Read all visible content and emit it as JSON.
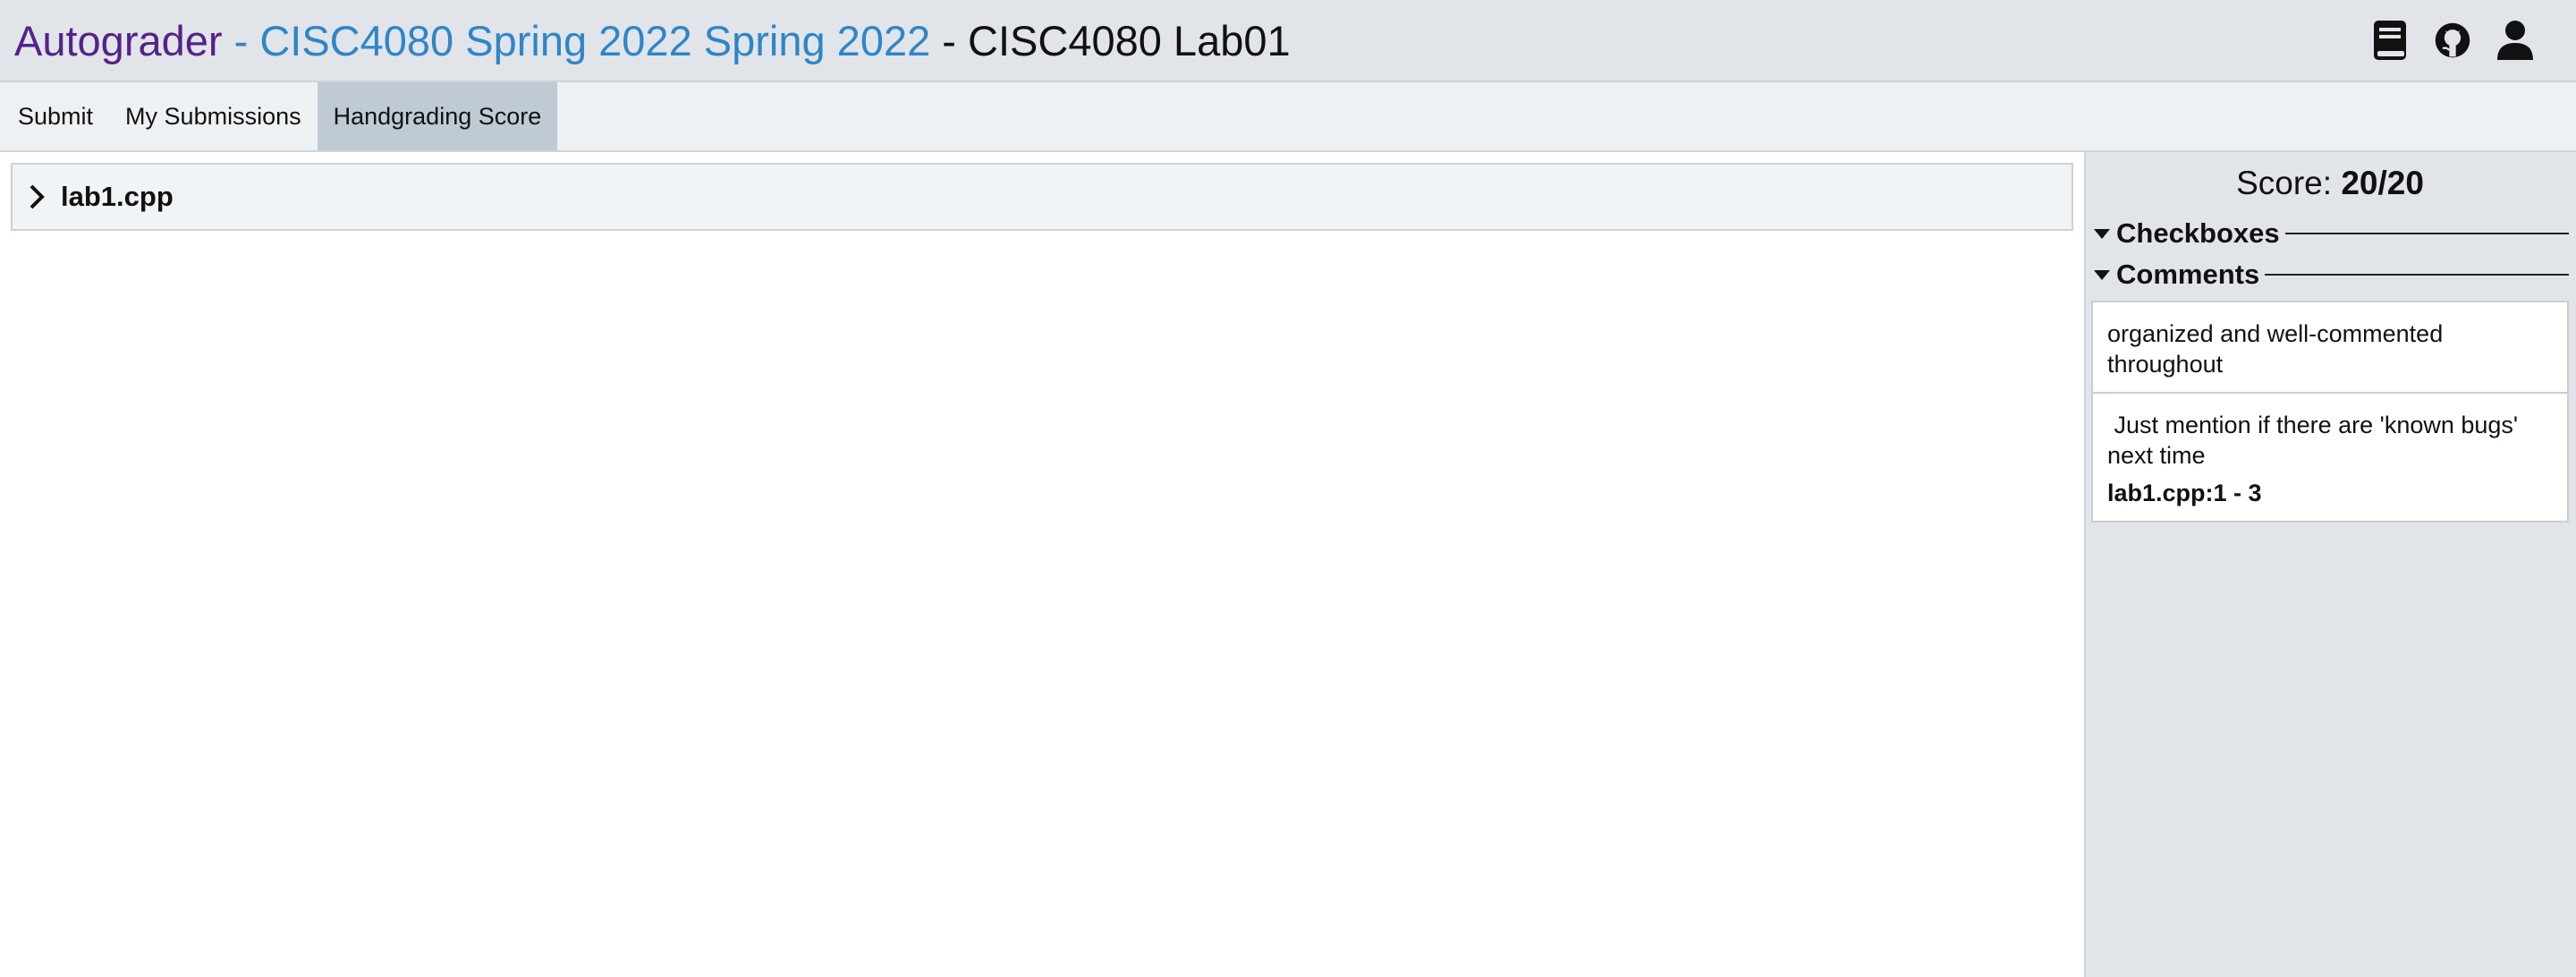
{
  "header": {
    "brand": "Autograder",
    "sep1": " - ",
    "course": "CISC4080 Spring 2022 Spring 2022",
    "sep2": " - ",
    "project": "CISC4080 Lab01",
    "icons": [
      "book-icon",
      "github-icon",
      "user-icon"
    ]
  },
  "tabs": [
    {
      "label": "Submit",
      "active": false
    },
    {
      "label": "My Submissions",
      "active": false
    },
    {
      "label": "Handgrading Score",
      "active": true
    }
  ],
  "files": [
    {
      "name": "lab1.cpp",
      "expanded": false
    }
  ],
  "sidebar": {
    "score_label": "Score: ",
    "score_value": "20/20",
    "checkboxes_title": "Checkboxes",
    "comments_title": "Comments",
    "comments": [
      {
        "text": "organized and well-commented throughout",
        "location": ""
      },
      {
        "text": " Just mention if there are 'known bugs' next time",
        "location": "lab1.cpp:1 - 3"
      }
    ]
  },
  "colors": {
    "brand": "#55228a",
    "link": "#2e86c9",
    "header_bg": "#e1e5e9",
    "active_tab": "#c0cad4"
  }
}
